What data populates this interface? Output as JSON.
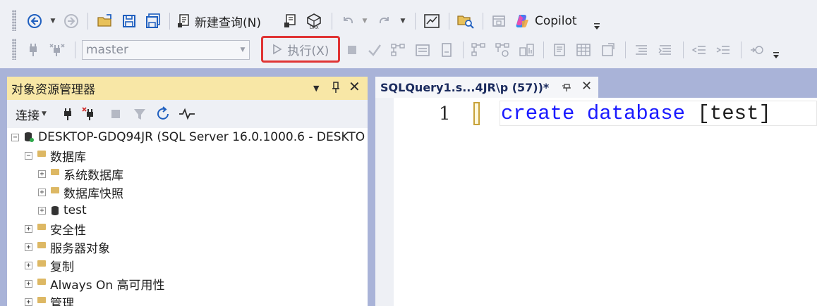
{
  "toolbar": {
    "new_query_label": "新建查询(N)",
    "copilot_label": "Copilot",
    "database_select": "master",
    "execute_label": "执行(X)"
  },
  "object_explorer": {
    "title": "对象资源管理器",
    "connect_label": "连接",
    "tree": {
      "server": "DESKTOP-GDQ94JR (SQL Server 16.0.1000.6 - DESKTO",
      "databases": "数据库",
      "system_databases": "系统数据库",
      "database_snapshots": "数据库快照",
      "test_db": "test",
      "security": "安全性",
      "server_objects": "服务器对象",
      "replication": "复制",
      "always_on": "Always On 高可用性",
      "management": "管理"
    }
  },
  "editor": {
    "tab_title": "SQLQuery1.s...4JR\\p (57))*",
    "line_number": "1",
    "code_keywords": "create database",
    "code_identifier": "[test]"
  },
  "colors": {
    "highlight_border": "#e03434",
    "panel_title_bg": "#f8e7a6",
    "background_band": "#a9b3d8",
    "sql_keyword": "#1a1aff"
  }
}
